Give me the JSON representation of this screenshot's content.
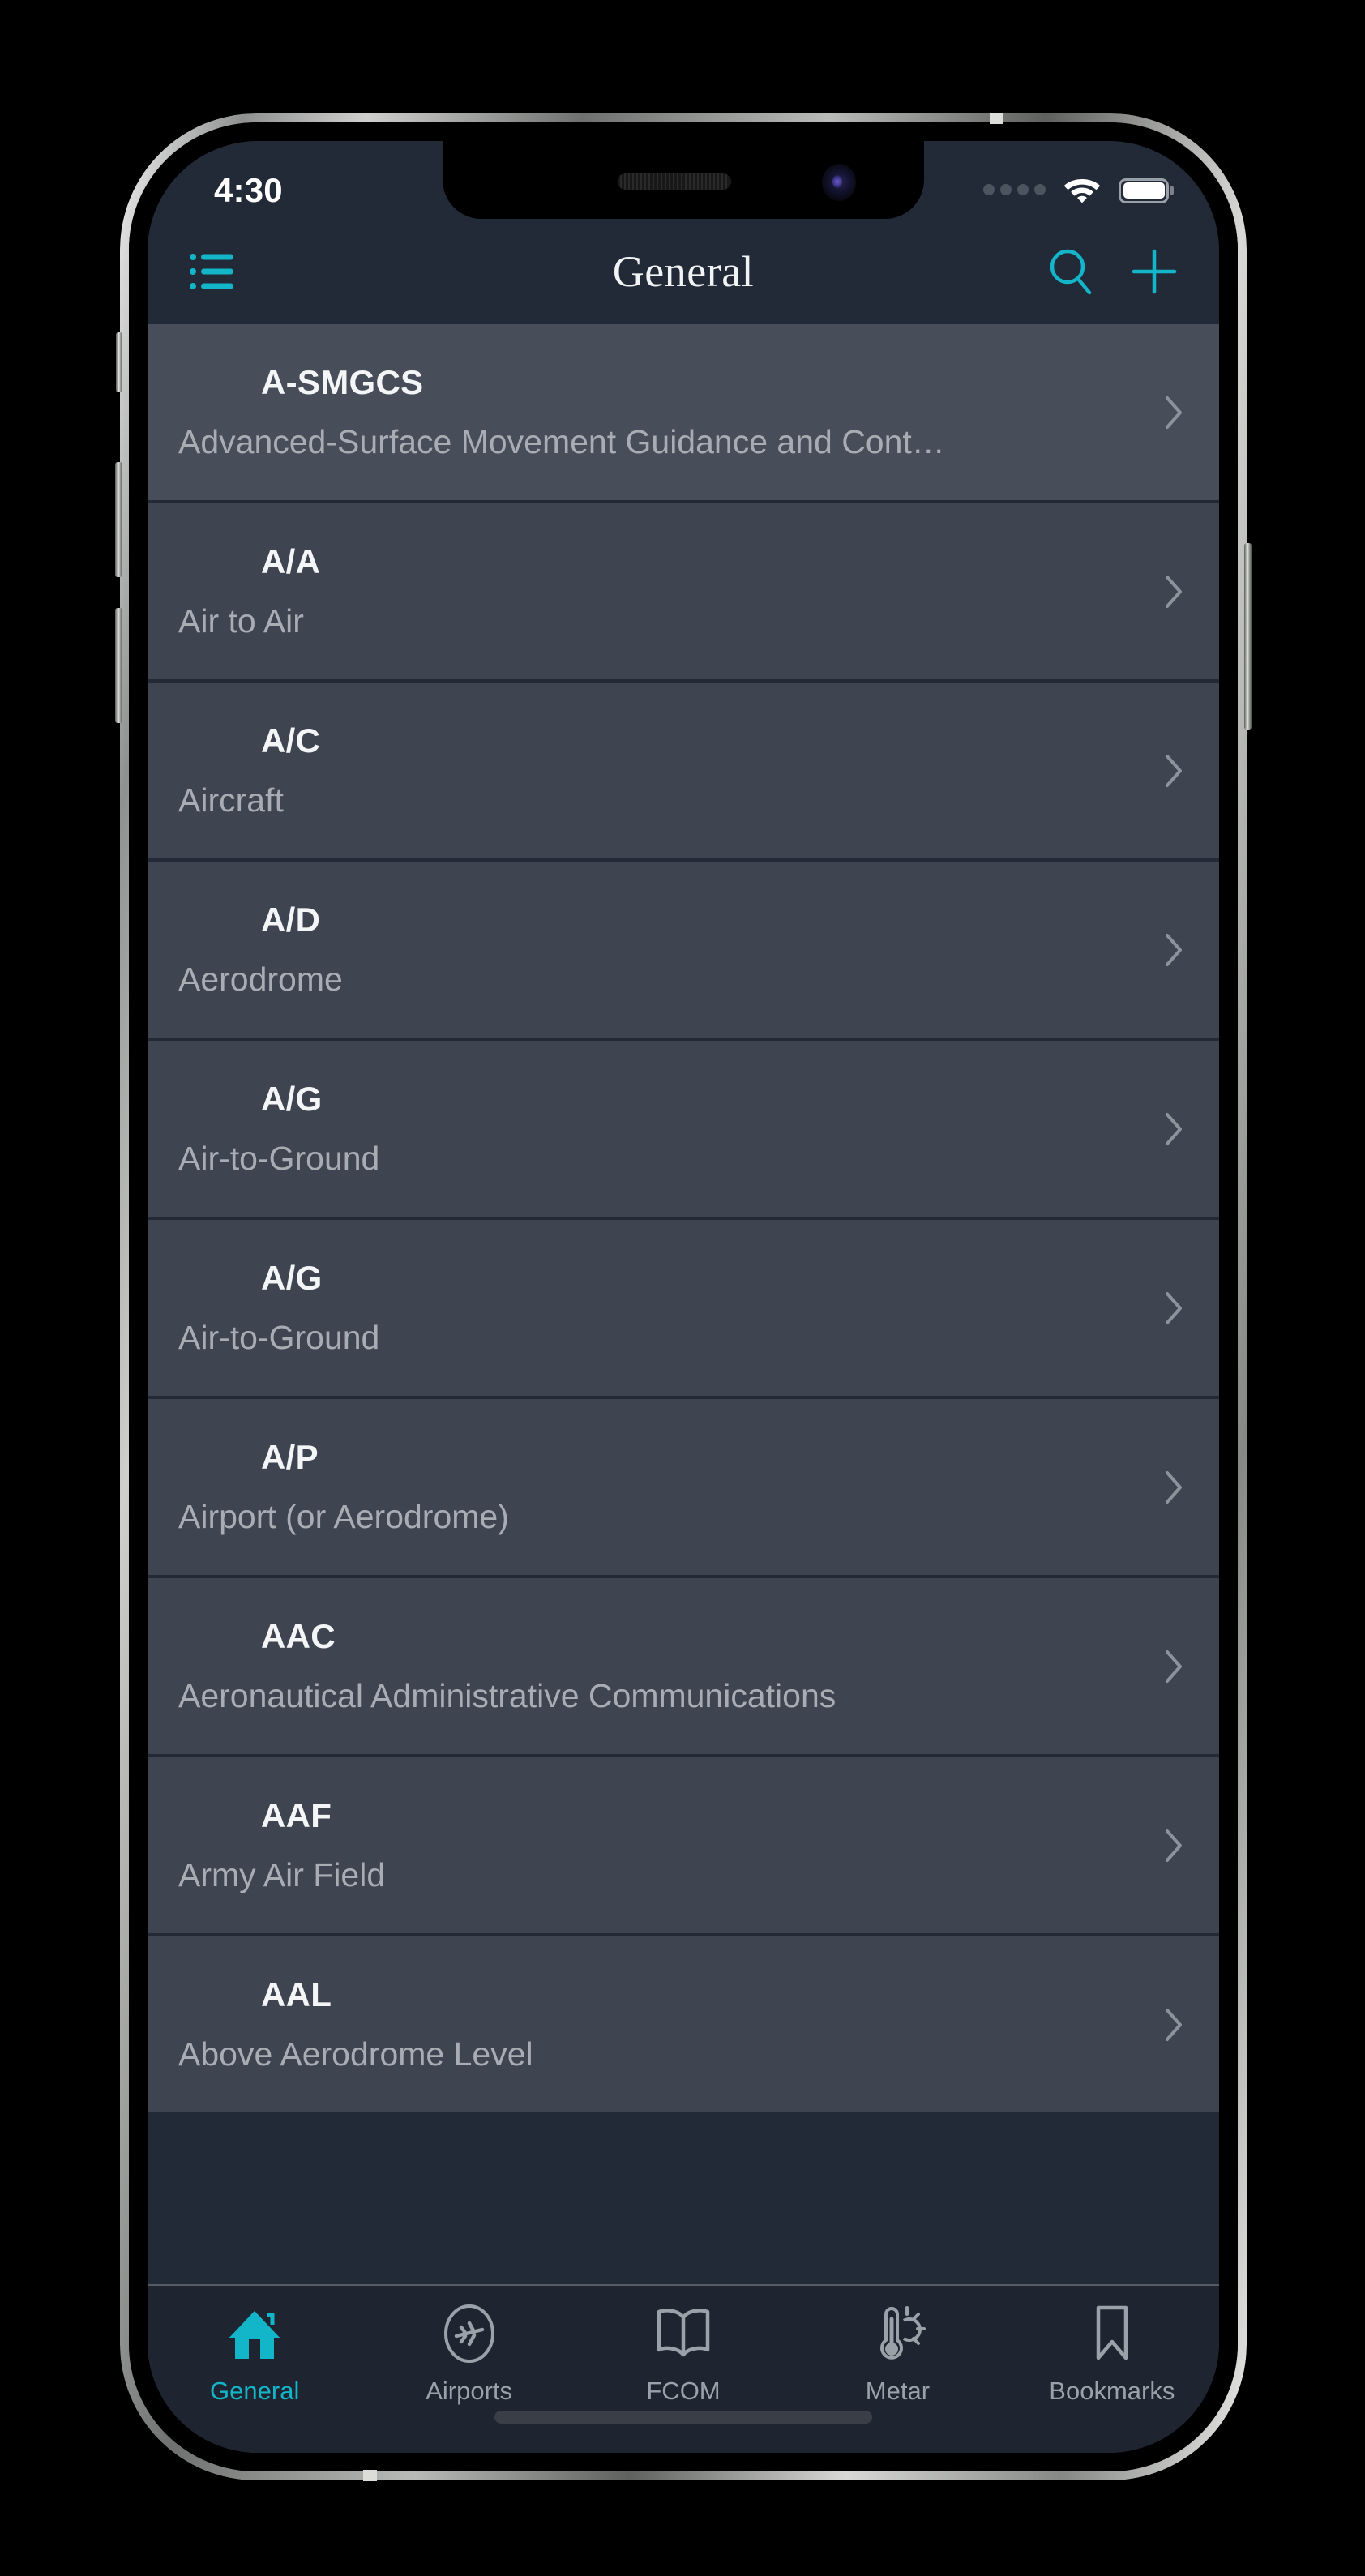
{
  "status_bar": {
    "time": "4:30",
    "signal_icon": "signal-dots-icon",
    "wifi_icon": "wifi-icon",
    "battery_icon": "battery-full-icon"
  },
  "nav_bar": {
    "menu_icon": "list-bullet-icon",
    "title": "General",
    "search_icon": "search-icon",
    "add_icon": "plus-icon",
    "accent_color": "#13b6c9"
  },
  "list": {
    "rows": [
      {
        "term": "A-SMGCS",
        "definition": "Advanced-Surface Movement Guidance and Cont…"
      },
      {
        "term": "A/A",
        "definition": "Air to Air"
      },
      {
        "term": "A/C",
        "definition": "Aircraft"
      },
      {
        "term": "A/D",
        "definition": "Aerodrome"
      },
      {
        "term": "A/G",
        "definition": "Air-to-Ground"
      },
      {
        "term": "A/G",
        "definition": "Air-to-Ground"
      },
      {
        "term": "A/P",
        "definition": "Airport (or Aerodrome)"
      },
      {
        "term": "AAC",
        "definition": "Aeronautical Administrative Communications"
      },
      {
        "term": "AAF",
        "definition": "Army Air Field"
      },
      {
        "term": "AAL",
        "definition": "Above Aerodrome Level"
      }
    ]
  },
  "tab_bar": {
    "active_index": 0,
    "items": [
      {
        "label": "General",
        "icon": "home-icon"
      },
      {
        "label": "Airports",
        "icon": "airplane-circle-icon"
      },
      {
        "label": "FCOM",
        "icon": "open-book-icon"
      },
      {
        "label": "Metar",
        "icon": "thermometer-sun-icon"
      },
      {
        "label": "Bookmarks",
        "icon": "bookmark-icon"
      }
    ]
  },
  "theme": {
    "screen_background": "#232a37",
    "row_background": "#3e4450",
    "accent": "#13b6c9",
    "text_primary": "#f4f5f6",
    "text_secondary": "#a8adb4"
  }
}
